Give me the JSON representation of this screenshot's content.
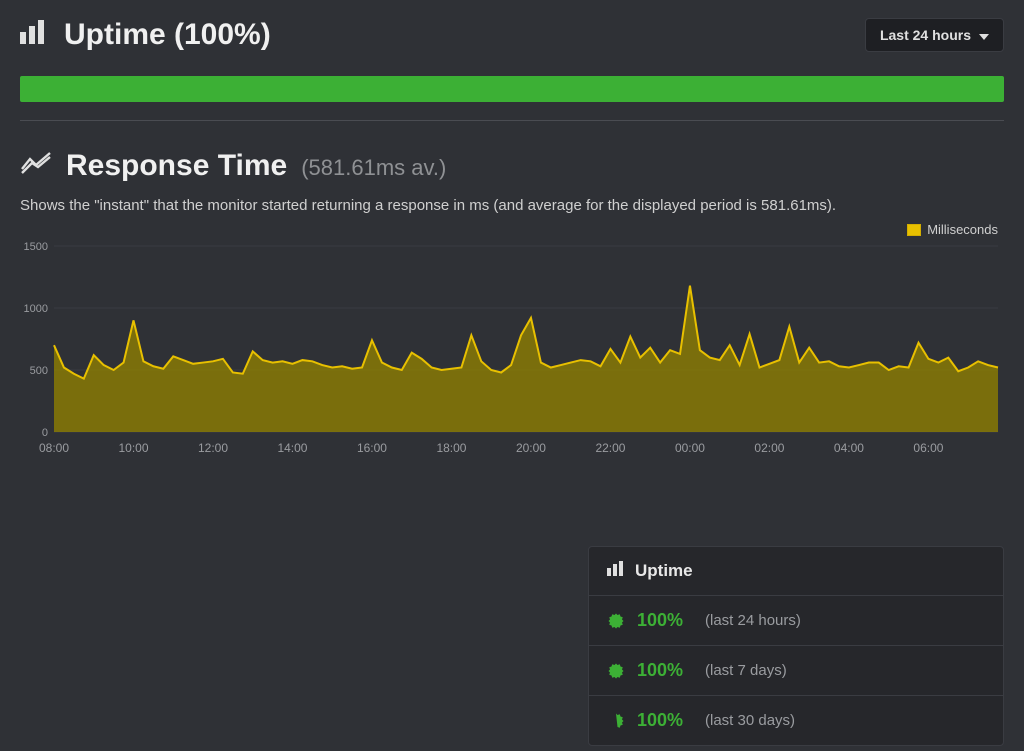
{
  "header": {
    "title": "Uptime (100%)",
    "range_label": "Last 24 hours"
  },
  "response": {
    "title": "Response Time",
    "avg_label": "(581.61ms av.)",
    "description": "Shows the \"instant\" that the monitor started returning a response in ms (and average for the displayed period is 581.61ms).",
    "legend": "Milliseconds"
  },
  "uptime_card": {
    "title": "Uptime",
    "rows": [
      {
        "pct": "100%",
        "period": "(last 24 hours)"
      },
      {
        "pct": "100%",
        "period": "(last 7 days)"
      },
      {
        "pct": "100%",
        "period": "(last 30 days)"
      }
    ]
  },
  "chart_data": {
    "type": "area",
    "title": "Response Time",
    "xlabel": "",
    "ylabel": "Milliseconds",
    "ylim": [
      0,
      1500
    ],
    "y_ticks": [
      0,
      500,
      1000,
      1500
    ],
    "x_ticks": [
      "08:00",
      "10:00",
      "12:00",
      "14:00",
      "16:00",
      "18:00",
      "20:00",
      "22:00",
      "00:00",
      "02:00",
      "04:00",
      "06:00"
    ],
    "legend": [
      "Milliseconds"
    ],
    "series": [
      {
        "name": "Milliseconds",
        "x": [
          "08:00",
          "08:15",
          "08:30",
          "08:45",
          "09:00",
          "09:15",
          "09:30",
          "09:45",
          "10:00",
          "10:15",
          "10:30",
          "10:45",
          "11:00",
          "11:15",
          "11:30",
          "11:45",
          "12:00",
          "12:15",
          "12:30",
          "12:45",
          "13:00",
          "13:15",
          "13:30",
          "13:45",
          "14:00",
          "14:15",
          "14:30",
          "14:45",
          "15:00",
          "15:15",
          "15:30",
          "15:45",
          "16:00",
          "16:15",
          "16:30",
          "16:45",
          "17:00",
          "17:15",
          "17:30",
          "17:45",
          "18:00",
          "18:15",
          "18:30",
          "18:45",
          "19:00",
          "19:15",
          "19:30",
          "19:45",
          "20:00",
          "20:15",
          "20:30",
          "20:45",
          "21:00",
          "21:15",
          "21:30",
          "21:45",
          "22:00",
          "22:15",
          "22:30",
          "22:45",
          "23:00",
          "23:15",
          "23:30",
          "23:45",
          "00:00",
          "00:15",
          "00:30",
          "00:45",
          "01:00",
          "01:15",
          "01:30",
          "01:45",
          "02:00",
          "02:15",
          "02:30",
          "02:45",
          "03:00",
          "03:15",
          "03:30",
          "03:45",
          "04:00",
          "04:15",
          "04:30",
          "04:45",
          "05:00",
          "05:15",
          "05:30",
          "05:45",
          "06:00",
          "06:15",
          "06:30",
          "06:45",
          "07:00",
          "07:15",
          "07:30",
          "07:45"
        ],
        "values": [
          700,
          520,
          470,
          430,
          620,
          540,
          500,
          560,
          900,
          570,
          530,
          510,
          610,
          580,
          550,
          560,
          570,
          590,
          480,
          470,
          650,
          580,
          560,
          570,
          550,
          580,
          570,
          540,
          520,
          530,
          510,
          520,
          740,
          560,
          520,
          500,
          640,
          590,
          520,
          500,
          510,
          520,
          780,
          570,
          500,
          480,
          540,
          780,
          920,
          560,
          520,
          540,
          560,
          580,
          570,
          530,
          670,
          560,
          770,
          600,
          680,
          560,
          660,
          630,
          1180,
          660,
          600,
          580,
          700,
          540,
          790,
          520,
          550,
          580,
          850,
          560,
          680,
          560,
          570,
          530,
          520,
          540,
          560,
          560,
          500,
          530,
          520,
          720,
          590,
          560,
          600,
          490,
          520,
          570,
          540,
          520
        ]
      }
    ]
  }
}
